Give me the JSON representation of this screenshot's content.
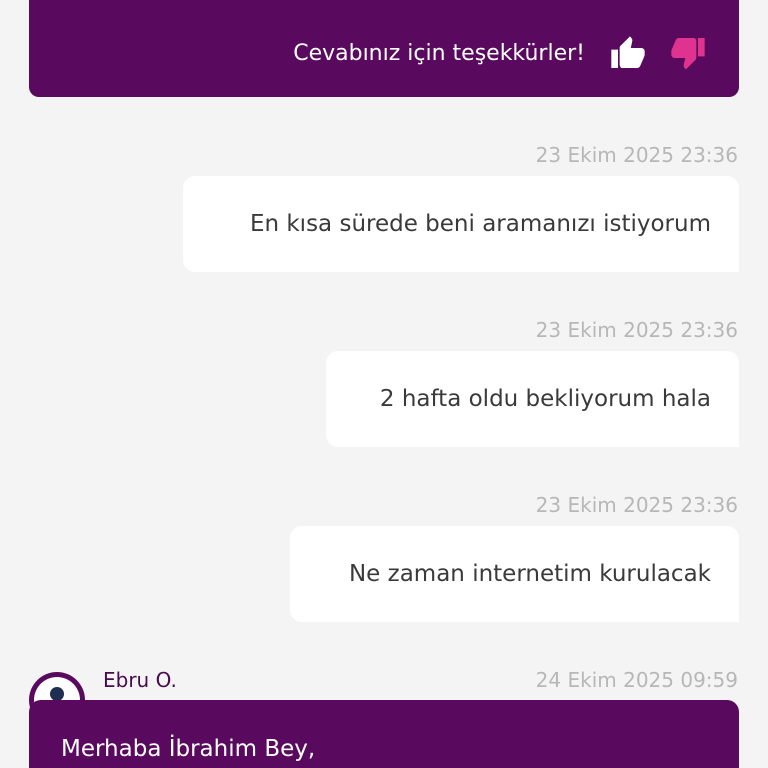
{
  "colors": {
    "page_background": "#f4f4f4",
    "agent_bubble": "#5a0a5e",
    "user_bubble": "#ffffff",
    "timestamp_text": "#b7b7b7",
    "thumb_up": "#ffffff",
    "thumb_down": "#e0338f"
  },
  "feedback": {
    "text": "Cevabınız için teşekkürler!",
    "thumb_up_icon": "thumbs-up-icon",
    "thumb_down_icon": "thumbs-down-icon"
  },
  "messages": [
    {
      "timestamp": "23 Ekim 2025 23:36",
      "text": "En kısa sürede beni aramanızı istiyorum"
    },
    {
      "timestamp": "23 Ekim 2025 23:36",
      "text": "2 hafta oldu bekliyorum hala"
    },
    {
      "timestamp": "23 Ekim 2025 23:36",
      "text": "Ne zaman internetim kurulacak"
    }
  ],
  "agent_message": {
    "name": "Ebru O.",
    "timestamp": "24 Ekim 2025 09:59",
    "avatar_icon": "user-avatar-icon",
    "text": "Merhaba İbrahim Bey,"
  }
}
